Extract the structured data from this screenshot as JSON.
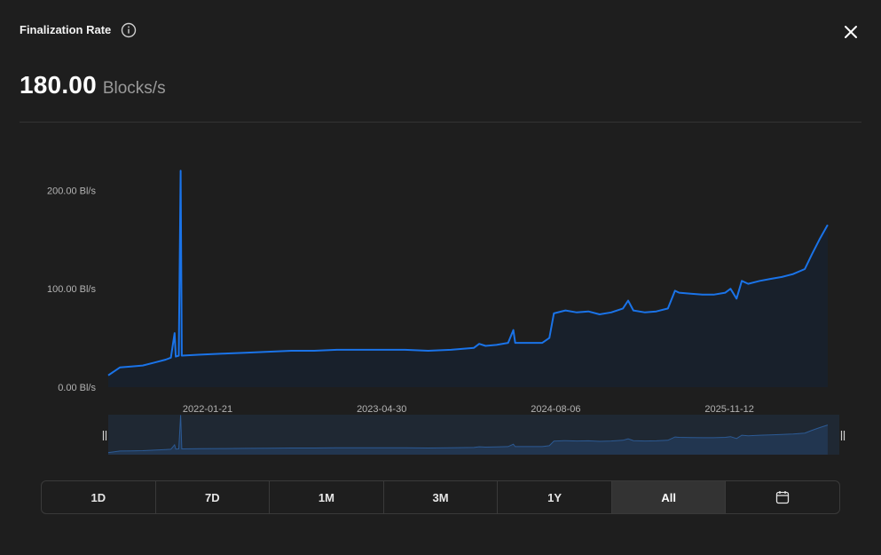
{
  "header": {
    "title": "Finalization Rate",
    "value": "180.00",
    "unit": "Blocks/s"
  },
  "colors": {
    "background": "#1e1e1e",
    "line": "#1a73e8",
    "area": "#18202b",
    "axis_text": "#b3b3b3"
  },
  "range": {
    "buttons": [
      "1D",
      "7D",
      "1M",
      "3M",
      "1Y",
      "All"
    ],
    "active": "All",
    "calendar_icon": "calendar-icon"
  },
  "chart_data": {
    "type": "area",
    "y_ticks": [
      "200.00 Bl/s",
      "100.00 Bl/s",
      "0.00 Bl/s"
    ],
    "y_tick_values": [
      200,
      100,
      0
    ],
    "x_ticks": [
      "2022-01-21",
      "2023-04-30",
      "2024-08-06",
      "2025-11-12"
    ],
    "x_tick_dates": [
      "2022-01-21",
      "2023-04-30",
      "2024-08-06",
      "2025-11-12"
    ],
    "ylim": [
      0,
      222
    ],
    "xlim": [
      "2021-05-01",
      "2026-09-01"
    ],
    "grid": false,
    "legend": "none",
    "series": [
      {
        "points": [
          [
            "2021-05-01",
            12
          ],
          [
            "2021-06-01",
            20
          ],
          [
            "2021-07-01",
            21
          ],
          [
            "2021-08-01",
            22
          ],
          [
            "2021-09-01",
            25
          ],
          [
            "2021-10-01",
            28
          ],
          [
            "2021-10-15",
            30
          ],
          [
            "2021-10-25",
            55
          ],
          [
            "2021-10-28",
            31
          ],
          [
            "2021-11-05",
            32
          ],
          [
            "2021-11-10",
            220
          ],
          [
            "2021-11-13",
            32
          ],
          [
            "2022-01-01",
            33
          ],
          [
            "2022-03-01",
            34
          ],
          [
            "2022-05-01",
            35
          ],
          [
            "2022-07-01",
            36
          ],
          [
            "2022-09-01",
            37
          ],
          [
            "2022-11-01",
            37
          ],
          [
            "2023-01-01",
            38
          ],
          [
            "2023-03-01",
            38
          ],
          [
            "2023-05-01",
            38
          ],
          [
            "2023-07-01",
            38
          ],
          [
            "2023-09-01",
            37
          ],
          [
            "2023-11-01",
            38
          ],
          [
            "2024-01-01",
            40
          ],
          [
            "2024-01-15",
            44
          ],
          [
            "2024-02-01",
            42
          ],
          [
            "2024-03-01",
            43
          ],
          [
            "2024-04-01",
            45
          ],
          [
            "2024-04-15",
            58
          ],
          [
            "2024-04-20",
            45
          ],
          [
            "2024-05-01",
            45
          ],
          [
            "2024-06-01",
            45
          ],
          [
            "2024-07-01",
            45
          ],
          [
            "2024-07-20",
            50
          ],
          [
            "2024-08-01",
            75
          ],
          [
            "2024-09-01",
            78
          ],
          [
            "2024-10-01",
            76
          ],
          [
            "2024-11-01",
            77
          ],
          [
            "2024-12-01",
            74
          ],
          [
            "2025-01-01",
            76
          ],
          [
            "2025-02-01",
            80
          ],
          [
            "2025-02-15",
            88
          ],
          [
            "2025-03-01",
            78
          ],
          [
            "2025-04-01",
            76
          ],
          [
            "2025-05-01",
            77
          ],
          [
            "2025-06-01",
            80
          ],
          [
            "2025-06-20",
            98
          ],
          [
            "2025-07-01",
            96
          ],
          [
            "2025-08-01",
            95
          ],
          [
            "2025-09-01",
            94
          ],
          [
            "2025-10-01",
            94
          ],
          [
            "2025-11-01",
            96
          ],
          [
            "2025-11-15",
            100
          ],
          [
            "2025-12-01",
            90
          ],
          [
            "2025-12-15",
            108
          ],
          [
            "2026-01-01",
            105
          ],
          [
            "2026-02-01",
            108
          ],
          [
            "2026-03-01",
            110
          ],
          [
            "2026-04-01",
            112
          ],
          [
            "2026-05-01",
            115
          ],
          [
            "2026-06-01",
            120
          ],
          [
            "2026-06-20",
            135
          ],
          [
            "2026-07-10",
            150
          ],
          [
            "2026-08-01",
            165
          ]
        ]
      }
    ]
  }
}
